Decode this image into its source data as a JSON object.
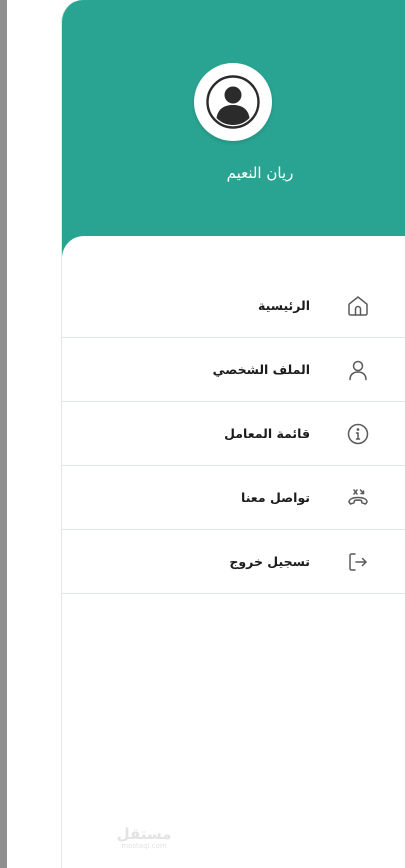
{
  "user": {
    "name": "ريان النعيم",
    "avatar_icon": "user-avatar-icon"
  },
  "colors": {
    "header": "#2aa492",
    "icon": "#5a5a5a",
    "divider": "#dde9e6",
    "text": "#1c1c1c"
  },
  "menu": {
    "items": [
      {
        "label": "الرئيسية",
        "icon": "home-icon"
      },
      {
        "label": "الملف الشخصي",
        "icon": "user-icon"
      },
      {
        "label": "قائمة المعامل",
        "icon": "info-icon"
      },
      {
        "label": "تواصل معنا",
        "icon": "phone-icon"
      },
      {
        "label": "تسجيل خروج",
        "icon": "logout-icon"
      }
    ]
  },
  "watermark": {
    "main": "مستقل",
    "sub": "mostaql.com"
  }
}
